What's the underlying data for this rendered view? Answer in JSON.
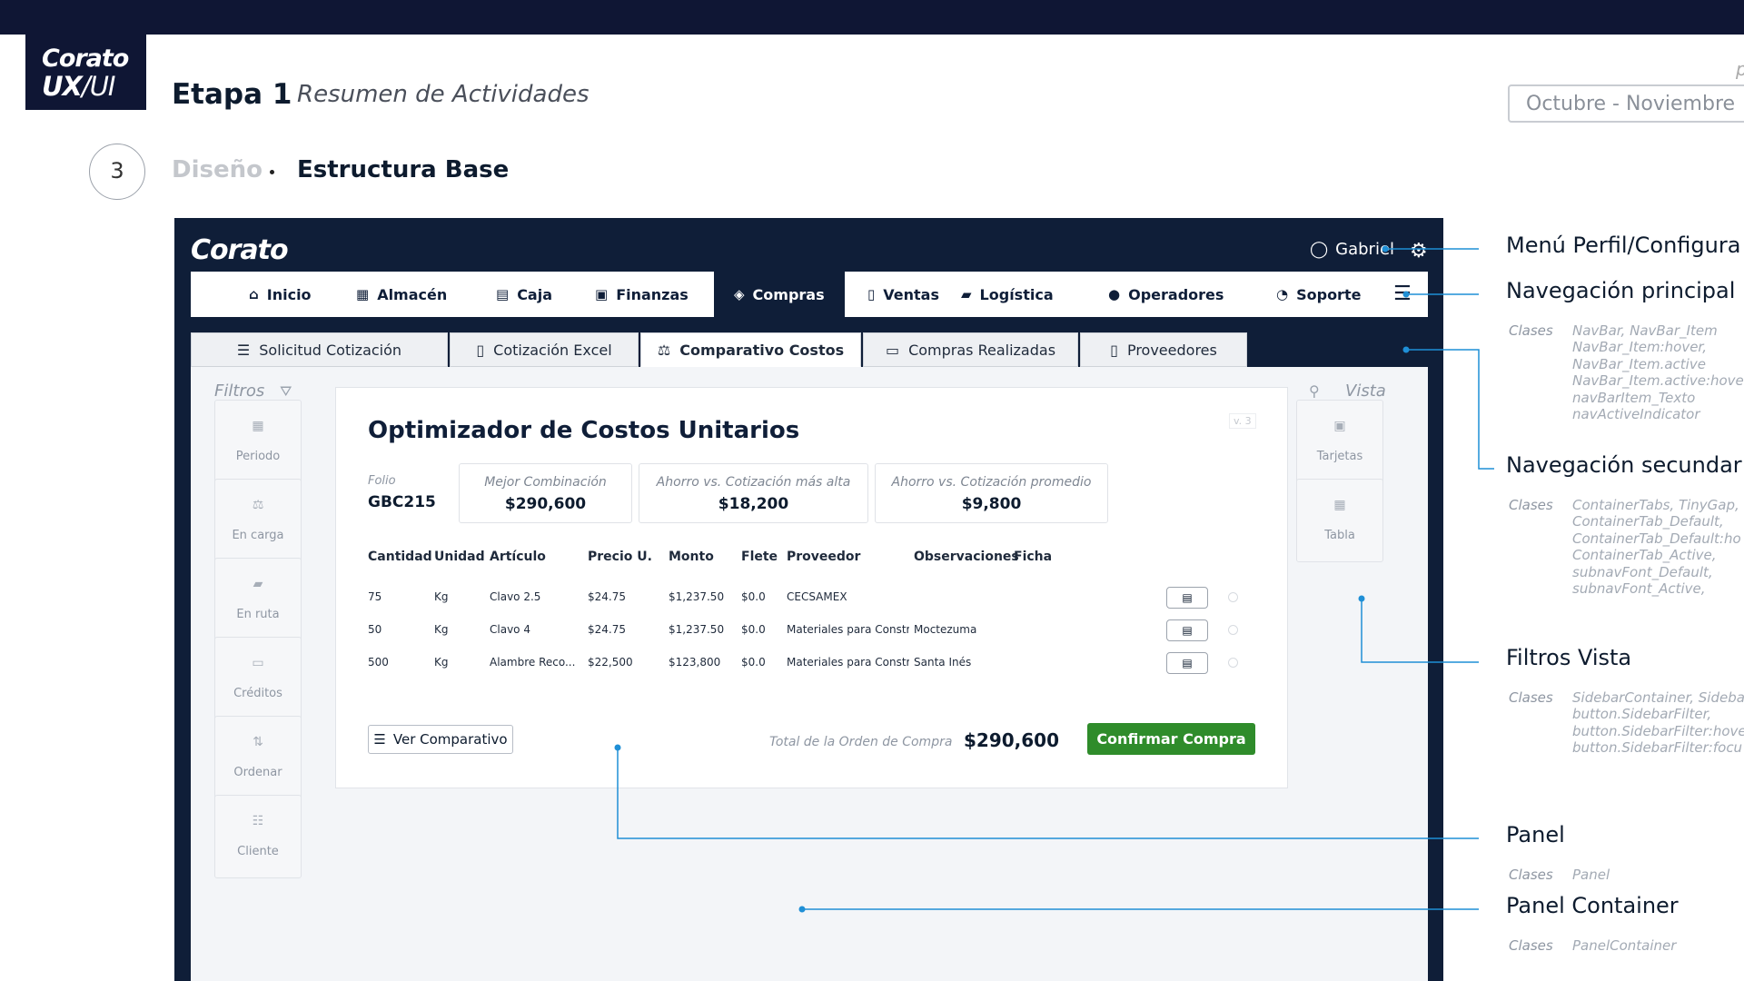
{
  "slide": {
    "logo_line1": "Corato",
    "logo_line2_bold": "UX",
    "logo_line2_rest": "/UI",
    "stage": "Etapa 1",
    "stage_subtitle": "Resumen de Actividades",
    "date_range": "Octubre - Noviembre",
    "corner_letter": "p",
    "step_number": "3",
    "crumb_section": "Diseño",
    "crumb_page": "Estructura Base"
  },
  "app": {
    "logo": "Corato",
    "user_name": "Gabriel",
    "main_nav": [
      {
        "label": "Inicio",
        "icon": "home-icon",
        "glyph": "⌂"
      },
      {
        "label": "Almacén",
        "icon": "warehouse-icon",
        "glyph": "▦"
      },
      {
        "label": "Caja",
        "icon": "cash-register-icon",
        "glyph": "▤"
      },
      {
        "label": "Finanzas",
        "icon": "money-icon",
        "glyph": "▣"
      },
      {
        "label": "Compras",
        "icon": "tags-icon",
        "glyph": "◈"
      },
      {
        "label": "Ventas",
        "icon": "file-invoice-icon",
        "glyph": "▯"
      },
      {
        "label": "Logística",
        "icon": "truck-icon",
        "glyph": "▰"
      },
      {
        "label": "Operadores",
        "icon": "user-icon",
        "glyph": "●"
      },
      {
        "label": "Soporte",
        "icon": "headset-icon",
        "glyph": "◔"
      }
    ],
    "active_nav": "Compras",
    "sub_nav": [
      {
        "label": "Solicitud Cotización",
        "icon": "list-check-icon",
        "glyph": "☰"
      },
      {
        "label": "Cotización Excel",
        "icon": "file-excel-icon",
        "glyph": "▯"
      },
      {
        "label": "Comparativo Costos",
        "icon": "balance-scale-icon",
        "glyph": "⚖"
      },
      {
        "label": "Compras Realizadas",
        "icon": "cart-check-icon",
        "glyph": "▭"
      },
      {
        "label": "Proveedores",
        "icon": "file-contract-icon",
        "glyph": "▯"
      }
    ],
    "active_sub": "Comparativo Costos",
    "filters": {
      "title": "Filtros",
      "items": [
        {
          "label": "Periodo",
          "icon": "calendar-icon",
          "glyph": "▦"
        },
        {
          "label": "En carga",
          "icon": "dolly-icon",
          "glyph": "⚖"
        },
        {
          "label": "En ruta",
          "icon": "truck-icon",
          "glyph": "▰"
        },
        {
          "label": "Créditos",
          "icon": "credit-card-icon",
          "glyph": "▭"
        },
        {
          "label": "Ordenar",
          "icon": "sort-icon",
          "glyph": "⇅"
        },
        {
          "label": "Cliente",
          "icon": "users-icon",
          "glyph": "☷"
        }
      ]
    },
    "view": {
      "title": "Vista",
      "items": [
        {
          "label": "Tarjetas",
          "icon": "cards-icon",
          "glyph": "▣"
        },
        {
          "label": "Tabla",
          "icon": "table-icon",
          "glyph": "▦"
        }
      ]
    },
    "panel": {
      "version": "v. 3",
      "title": "Optimizador de Costos Unitarios",
      "folio_label": "Folio",
      "folio_value": "GBC215",
      "kpis": [
        {
          "label": "Mejor Combinación",
          "value": "$290,600"
        },
        {
          "label": "Ahorro vs. Cotización más alta",
          "value": "$18,200"
        },
        {
          "label": "Ahorro vs. Cotización promedio",
          "value": "$9,800"
        }
      ],
      "columns": [
        "Cantidad",
        "Unidad",
        "Artículo",
        "Precio U.",
        "Monto",
        "Flete",
        "Proveedor",
        "Observaciones",
        "Ficha"
      ],
      "rows": [
        [
          "75",
          "Kg",
          "Clavo 2.5",
          "$24.75",
          "$1,237.50",
          "$0.0",
          "CECSAMEX",
          ""
        ],
        [
          "50",
          "Kg",
          "Clavo 4",
          "$24.75",
          "$1,237.50",
          "$0.0",
          "Materiales para Constr...",
          "Moctezuma"
        ],
        [
          "500",
          "Kg",
          "Alambre Reco...",
          "$22,500",
          "$123,800",
          "$0.0",
          "Materiales para Constr...",
          "Santa Inés"
        ]
      ],
      "ver_button": "Ver Comparativo",
      "total_label": "Total de la Orden de Compra",
      "total_value": "$290,600",
      "confirm_button": "Confirmar Compra"
    }
  },
  "annotations": [
    {
      "title": "Menú Perfil/Configura",
      "classes": []
    },
    {
      "title": "Navegación principal",
      "classes_label": "Clases",
      "classes": [
        "NavBar, NavBar_Item",
        "NavBar_Item:hover,",
        "NavBar_Item.active",
        "NavBar_Item.active:hove",
        "navBarItem_Texto",
        "navActiveIndicator"
      ]
    },
    {
      "title": "Navegación secundar",
      "classes_label": "Clases",
      "classes": [
        "ContainerTabs, TinyGap,",
        "ContainerTab_Default,",
        "ContainerTab_Default:ho",
        "ContainerTab_Active,",
        "subnavFont_Default,",
        "subnavFont_Active,"
      ]
    },
    {
      "title": "Filtros Vista",
      "classes_label": "Clases",
      "classes": [
        "SidebarContainer, Sideba",
        "button.SidebarFilter,",
        "button.SidebarFilter:hove",
        "button.SidebarFilter:focu"
      ]
    },
    {
      "title": "Panel",
      "classes_label": "Clases",
      "classes": [
        "Panel"
      ]
    },
    {
      "title": "Panel Container",
      "classes_label": "Clases",
      "classes": [
        "PanelContainer"
      ]
    }
  ],
  "colors": {
    "navy": "#0f1e38",
    "confirm_green": "#2f8c2b",
    "annotation_line": "#1f8fd6"
  }
}
